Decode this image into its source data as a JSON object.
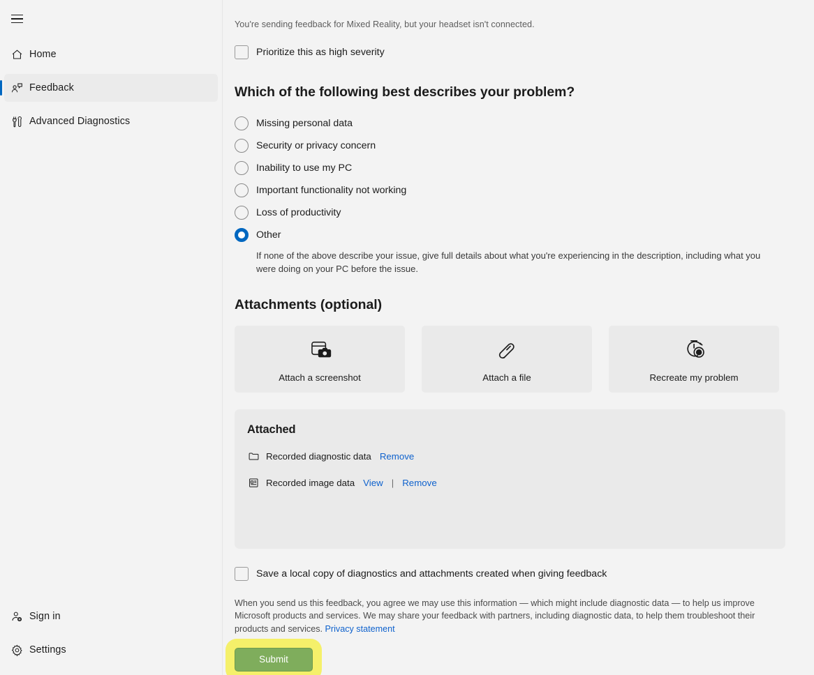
{
  "sidebar": {
    "menu_button": "hamburger-menu",
    "items": [
      {
        "label": "Home",
        "icon": "home-icon",
        "selected": false
      },
      {
        "label": "Feedback",
        "icon": "feedback-icon",
        "selected": true
      },
      {
        "label": "Advanced Diagnostics",
        "icon": "tools-icon",
        "selected": false
      }
    ],
    "bottom_items": [
      {
        "label": "Sign in",
        "icon": "person-add-icon"
      },
      {
        "label": "Settings",
        "icon": "gear-icon"
      }
    ]
  },
  "main": {
    "notice": "You're sending feedback for Mixed Reality, but your headset isn't connected.",
    "severity_checkbox": {
      "label": "Prioritize this as high severity",
      "checked": false
    },
    "problem_section": {
      "title": "Which of the following best describes your problem?",
      "options": [
        {
          "label": "Missing personal data",
          "selected": false
        },
        {
          "label": "Security or privacy concern",
          "selected": false
        },
        {
          "label": "Inability to use my PC",
          "selected": false
        },
        {
          "label": "Important functionality not working",
          "selected": false
        },
        {
          "label": "Loss of productivity",
          "selected": false
        },
        {
          "label": "Other",
          "selected": true
        }
      ],
      "other_help": "If none of the above describe your issue, give full details about what you're experiencing in the description, including what you were doing on your PC before the issue."
    },
    "attachments": {
      "title": "Attachments (optional)",
      "cards": [
        {
          "label": "Attach a screenshot",
          "icon": "screenshot-camera-icon"
        },
        {
          "label": "Attach a file",
          "icon": "paperclip-icon"
        },
        {
          "label": "Recreate my problem",
          "icon": "stopwatch-record-icon"
        }
      ]
    },
    "attached": {
      "title": "Attached",
      "items": [
        {
          "name": "Recorded diagnostic data",
          "icon": "folder-icon",
          "view_label": null,
          "remove_label": "Remove"
        },
        {
          "name": "Recorded image data",
          "icon": "image-file-icon",
          "view_label": "View",
          "separator": "|",
          "remove_label": "Remove"
        }
      ]
    },
    "save_copy_checkbox": {
      "label": "Save a local copy of diagnostics and attachments created when giving feedback",
      "checked": false
    },
    "legal": {
      "text": "When you send us this feedback, you agree we may use this information — which might include diagnostic data — to help us improve Microsoft products and services. We may share your feedback with partners, including diagnostic data, to help them troubleshoot their products and services. ",
      "privacy_link": "Privacy statement"
    },
    "submit": {
      "label": "Submit",
      "highlighted": true,
      "button_color": "#7fad5c",
      "highlight_color": "#f5f06a"
    }
  },
  "colors": {
    "accent": "#0067c0",
    "link": "#0f62cd",
    "page_background": "#f3f3f3",
    "panel_background": "#eaeaea",
    "selected_nav_background": "#ebebeb"
  }
}
